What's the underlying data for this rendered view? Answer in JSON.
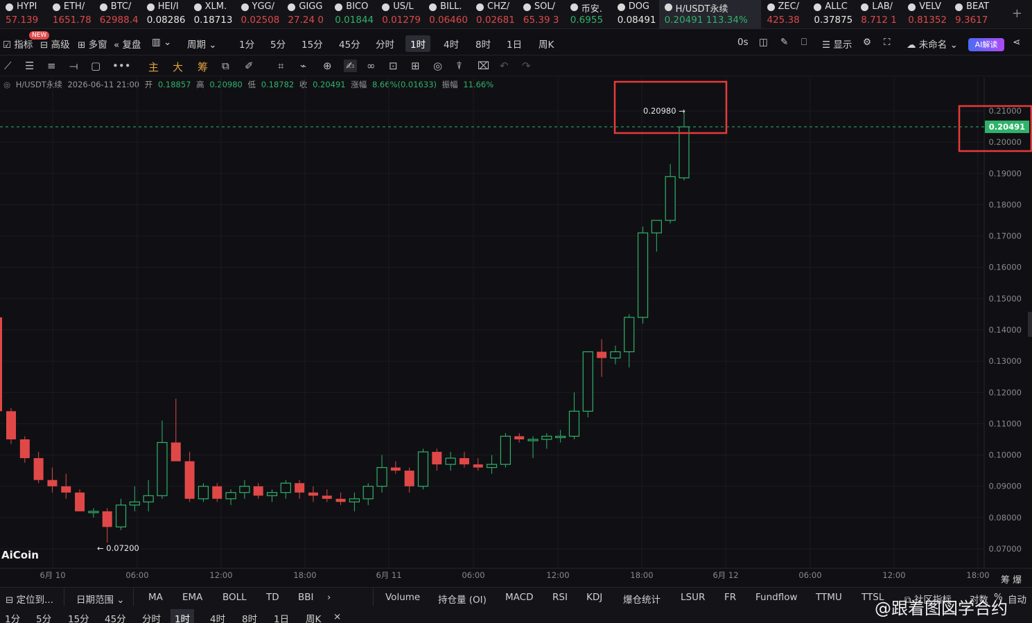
{
  "ticker": [
    {
      "sym": "HYPI",
      "px": "57.139",
      "c": "#e04848"
    },
    {
      "sym": "ETH/",
      "px": "1651.78",
      "c": "#e04848"
    },
    {
      "sym": "BTC/",
      "px": "62988.4",
      "c": "#e04848"
    },
    {
      "sym": "HEI/I",
      "px": "0.08286",
      "c": "#e8e8e8"
    },
    {
      "sym": "XLM.",
      "px": "0.18713",
      "c": "#e8e8e8"
    },
    {
      "sym": "YGG/",
      "px": "0.02508",
      "c": "#e04848"
    },
    {
      "sym": "GIGG",
      "px": "27.24 0",
      "c": "#e04848"
    },
    {
      "sym": "BICO",
      "px": "0.01844",
      "c": "#2fb36a"
    },
    {
      "sym": "US/L",
      "px": "0.01279",
      "c": "#e04848"
    },
    {
      "sym": "BILL.",
      "px": "0.06460",
      "c": "#e04848"
    },
    {
      "sym": "CHZ/",
      "px": "0.02681",
      "c": "#e04848"
    },
    {
      "sym": "SOL/",
      "px": "65.39 3",
      "c": "#e04848"
    },
    {
      "sym": "币安.",
      "px": "0.6955",
      "c": "#2fb36a"
    },
    {
      "sym": "DOG",
      "px": "0.08491",
      "c": "#e8e8e8"
    },
    {
      "sym": "H/USDT永续",
      "px": "0.20491 113.34%",
      "c": "#2fb36a",
      "active": true
    },
    {
      "sym": "ZEC/",
      "px": "425.38",
      "c": "#e04848"
    },
    {
      "sym": "ALLC",
      "px": "0.37875",
      "c": "#e8e8e8"
    },
    {
      "sym": "LAB/",
      "px": "8.712 1",
      "c": "#e04848"
    },
    {
      "sym": "VELV",
      "px": "0.81352",
      "c": "#e04848"
    },
    {
      "sym": "BEAT",
      "px": "9.3617",
      "c": "#e04848"
    }
  ],
  "toolbar": {
    "new_badge": "NEW",
    "indicator": "指标",
    "advanced": "高级",
    "multi": "多窗",
    "replay": "复盘",
    "period": "周期",
    "intervals": [
      "1分",
      "5分",
      "15分",
      "45分",
      "分时",
      "1时",
      "4时",
      "8时",
      "1日",
      "周K"
    ],
    "selected_interval": "1时",
    "zero": "0s",
    "display": "显示",
    "unnamed": "未命名",
    "ai": "AI解读"
  },
  "draw_tools": {
    "main": "主",
    "big": "大",
    "chip": "筹"
  },
  "info": {
    "pair": "H/USDT永续",
    "time": "2026-06-11 21:00",
    "open_l": "开",
    "open": "0.18857",
    "high_l": "高",
    "high": "0.20980",
    "low_l": "低",
    "low": "0.18782",
    "close_l": "收",
    "close": "0.20491",
    "chg_l": "涨幅",
    "chg": "8.66%(0.01633)",
    "amp_l": "振幅",
    "amp": "11.66%"
  },
  "chart_data": {
    "type": "candlestick",
    "current_price": 0.20491,
    "high_label": "0.20980 →",
    "low_label": "← 0.07200",
    "y_ticks": [
      "0.21000",
      "0.20000",
      "0.19000",
      "0.18000",
      "0.17000",
      "0.16000",
      "0.15000",
      "0.14000",
      "0.13000",
      "0.12000",
      "0.11000",
      "0.10000",
      "0.09000",
      "0.08000",
      "0.07000"
    ],
    "y_range": [
      0.0655,
      0.2135
    ],
    "x_ticks": [
      "6月 10",
      "06:00",
      "12:00",
      "18:00",
      "6月 11",
      "06:00",
      "12:00",
      "18:00",
      "6月 12",
      "06:00",
      "12:00",
      "18:00"
    ],
    "candles": [
      [
        0.114,
        0.115,
        0.1035,
        0.105
      ],
      [
        0.105,
        0.106,
        0.0975,
        0.099
      ],
      [
        0.099,
        0.101,
        0.091,
        0.092
      ],
      [
        0.092,
        0.096,
        0.088,
        0.09
      ],
      [
        0.09,
        0.094,
        0.086,
        0.088
      ],
      [
        0.088,
        0.089,
        0.082,
        0.082
      ],
      [
        0.082,
        0.083,
        0.08,
        0.082
      ],
      [
        0.082,
        0.083,
        0.072,
        0.077
      ],
      [
        0.077,
        0.086,
        0.076,
        0.084
      ],
      [
        0.084,
        0.09,
        0.082,
        0.085
      ],
      [
        0.085,
        0.092,
        0.082,
        0.087
      ],
      [
        0.087,
        0.111,
        0.086,
        0.104
      ],
      [
        0.104,
        0.118,
        0.098,
        0.098
      ],
      [
        0.098,
        0.101,
        0.085,
        0.086
      ],
      [
        0.086,
        0.091,
        0.085,
        0.09
      ],
      [
        0.09,
        0.091,
        0.085,
        0.086
      ],
      [
        0.086,
        0.089,
        0.084,
        0.088
      ],
      [
        0.088,
        0.092,
        0.086,
        0.09
      ],
      [
        0.09,
        0.091,
        0.086,
        0.087
      ],
      [
        0.087,
        0.089,
        0.085,
        0.088
      ],
      [
        0.088,
        0.092,
        0.086,
        0.091
      ],
      [
        0.091,
        0.092,
        0.086,
        0.088
      ],
      [
        0.088,
        0.09,
        0.085,
        0.087
      ],
      [
        0.087,
        0.089,
        0.085,
        0.086
      ],
      [
        0.086,
        0.088,
        0.084,
        0.085
      ],
      [
        0.085,
        0.088,
        0.082,
        0.086
      ],
      [
        0.086,
        0.091,
        0.084,
        0.09
      ],
      [
        0.09,
        0.1,
        0.088,
        0.096
      ],
      [
        0.096,
        0.098,
        0.094,
        0.095
      ],
      [
        0.095,
        0.096,
        0.088,
        0.09
      ],
      [
        0.09,
        0.102,
        0.089,
        0.101
      ],
      [
        0.101,
        0.102,
        0.095,
        0.097
      ],
      [
        0.097,
        0.101,
        0.095,
        0.099
      ],
      [
        0.099,
        0.101,
        0.096,
        0.097
      ],
      [
        0.097,
        0.099,
        0.095,
        0.096
      ],
      [
        0.096,
        0.1,
        0.094,
        0.097
      ],
      [
        0.097,
        0.107,
        0.096,
        0.106
      ],
      [
        0.106,
        0.107,
        0.104,
        0.105
      ],
      [
        0.105,
        0.106,
        0.099,
        0.105
      ],
      [
        0.105,
        0.107,
        0.102,
        0.106
      ],
      [
        0.106,
        0.108,
        0.104,
        0.106
      ],
      [
        0.106,
        0.12,
        0.105,
        0.114
      ],
      [
        0.114,
        0.13,
        0.112,
        0.133
      ],
      [
        0.133,
        0.137,
        0.125,
        0.131
      ],
      [
        0.131,
        0.135,
        0.129,
        0.133
      ],
      [
        0.133,
        0.145,
        0.128,
        0.144
      ],
      [
        0.144,
        0.173,
        0.142,
        0.171
      ],
      [
        0.171,
        0.175,
        0.165,
        0.175
      ],
      [
        0.175,
        0.193,
        0.174,
        0.189
      ],
      [
        0.1886,
        0.2098,
        0.1878,
        0.2049
      ]
    ]
  },
  "bottom": {
    "locate": "定位到...",
    "date_range": "日期范围",
    "indicators": [
      "MA",
      "EMA",
      "BOLL",
      "TD",
      "BBI"
    ],
    "sub": [
      "Volume",
      "持仓量 (OI)",
      "MACD",
      "RSI",
      "KDJ",
      "爆仓统计",
      "LSUR",
      "FR",
      "Fundflow",
      "TTMU",
      "TTSL"
    ],
    "community": "社区指标",
    "ratio": "对数",
    "pct": "%",
    "auto": "自动",
    "intervals": [
      "1分",
      "5分",
      "15分",
      "45分",
      "分时",
      "1时",
      "4时",
      "8时",
      "1日",
      "周K"
    ],
    "selected": "1时",
    "chip": "筹",
    "burst": "爆"
  },
  "logo": "AiCoin",
  "watermark": "@跟着图図学合约",
  "colors": {
    "up": "#2fb36a",
    "down": "#e04848",
    "highlight": "#e83a3a"
  }
}
